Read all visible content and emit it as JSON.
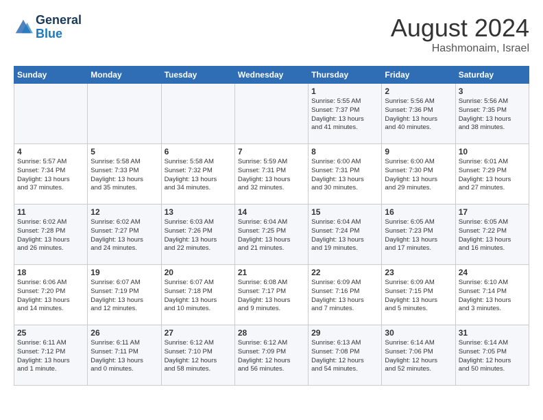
{
  "header": {
    "logo_line1": "General",
    "logo_line2": "Blue",
    "month_year": "August 2024",
    "location": "Hashmonaim, Israel"
  },
  "days_of_week": [
    "Sunday",
    "Monday",
    "Tuesday",
    "Wednesday",
    "Thursday",
    "Friday",
    "Saturday"
  ],
  "weeks": [
    [
      {
        "day": "",
        "info": ""
      },
      {
        "day": "",
        "info": ""
      },
      {
        "day": "",
        "info": ""
      },
      {
        "day": "",
        "info": ""
      },
      {
        "day": "1",
        "info": "Sunrise: 5:55 AM\nSunset: 7:37 PM\nDaylight: 13 hours\nand 41 minutes."
      },
      {
        "day": "2",
        "info": "Sunrise: 5:56 AM\nSunset: 7:36 PM\nDaylight: 13 hours\nand 40 minutes."
      },
      {
        "day": "3",
        "info": "Sunrise: 5:56 AM\nSunset: 7:35 PM\nDaylight: 13 hours\nand 38 minutes."
      }
    ],
    [
      {
        "day": "4",
        "info": "Sunrise: 5:57 AM\nSunset: 7:34 PM\nDaylight: 13 hours\nand 37 minutes."
      },
      {
        "day": "5",
        "info": "Sunrise: 5:58 AM\nSunset: 7:33 PM\nDaylight: 13 hours\nand 35 minutes."
      },
      {
        "day": "6",
        "info": "Sunrise: 5:58 AM\nSunset: 7:32 PM\nDaylight: 13 hours\nand 34 minutes."
      },
      {
        "day": "7",
        "info": "Sunrise: 5:59 AM\nSunset: 7:31 PM\nDaylight: 13 hours\nand 32 minutes."
      },
      {
        "day": "8",
        "info": "Sunrise: 6:00 AM\nSunset: 7:31 PM\nDaylight: 13 hours\nand 30 minutes."
      },
      {
        "day": "9",
        "info": "Sunrise: 6:00 AM\nSunset: 7:30 PM\nDaylight: 13 hours\nand 29 minutes."
      },
      {
        "day": "10",
        "info": "Sunrise: 6:01 AM\nSunset: 7:29 PM\nDaylight: 13 hours\nand 27 minutes."
      }
    ],
    [
      {
        "day": "11",
        "info": "Sunrise: 6:02 AM\nSunset: 7:28 PM\nDaylight: 13 hours\nand 26 minutes."
      },
      {
        "day": "12",
        "info": "Sunrise: 6:02 AM\nSunset: 7:27 PM\nDaylight: 13 hours\nand 24 minutes."
      },
      {
        "day": "13",
        "info": "Sunrise: 6:03 AM\nSunset: 7:26 PM\nDaylight: 13 hours\nand 22 minutes."
      },
      {
        "day": "14",
        "info": "Sunrise: 6:04 AM\nSunset: 7:25 PM\nDaylight: 13 hours\nand 21 minutes."
      },
      {
        "day": "15",
        "info": "Sunrise: 6:04 AM\nSunset: 7:24 PM\nDaylight: 13 hours\nand 19 minutes."
      },
      {
        "day": "16",
        "info": "Sunrise: 6:05 AM\nSunset: 7:23 PM\nDaylight: 13 hours\nand 17 minutes."
      },
      {
        "day": "17",
        "info": "Sunrise: 6:05 AM\nSunset: 7:22 PM\nDaylight: 13 hours\nand 16 minutes."
      }
    ],
    [
      {
        "day": "18",
        "info": "Sunrise: 6:06 AM\nSunset: 7:20 PM\nDaylight: 13 hours\nand 14 minutes."
      },
      {
        "day": "19",
        "info": "Sunrise: 6:07 AM\nSunset: 7:19 PM\nDaylight: 13 hours\nand 12 minutes."
      },
      {
        "day": "20",
        "info": "Sunrise: 6:07 AM\nSunset: 7:18 PM\nDaylight: 13 hours\nand 10 minutes."
      },
      {
        "day": "21",
        "info": "Sunrise: 6:08 AM\nSunset: 7:17 PM\nDaylight: 13 hours\nand 9 minutes."
      },
      {
        "day": "22",
        "info": "Sunrise: 6:09 AM\nSunset: 7:16 PM\nDaylight: 13 hours\nand 7 minutes."
      },
      {
        "day": "23",
        "info": "Sunrise: 6:09 AM\nSunset: 7:15 PM\nDaylight: 13 hours\nand 5 minutes."
      },
      {
        "day": "24",
        "info": "Sunrise: 6:10 AM\nSunset: 7:14 PM\nDaylight: 13 hours\nand 3 minutes."
      }
    ],
    [
      {
        "day": "25",
        "info": "Sunrise: 6:11 AM\nSunset: 7:12 PM\nDaylight: 13 hours\nand 1 minute."
      },
      {
        "day": "26",
        "info": "Sunrise: 6:11 AM\nSunset: 7:11 PM\nDaylight: 13 hours\nand 0 minutes."
      },
      {
        "day": "27",
        "info": "Sunrise: 6:12 AM\nSunset: 7:10 PM\nDaylight: 12 hours\nand 58 minutes."
      },
      {
        "day": "28",
        "info": "Sunrise: 6:12 AM\nSunset: 7:09 PM\nDaylight: 12 hours\nand 56 minutes."
      },
      {
        "day": "29",
        "info": "Sunrise: 6:13 AM\nSunset: 7:08 PM\nDaylight: 12 hours\nand 54 minutes."
      },
      {
        "day": "30",
        "info": "Sunrise: 6:14 AM\nSunset: 7:06 PM\nDaylight: 12 hours\nand 52 minutes."
      },
      {
        "day": "31",
        "info": "Sunrise: 6:14 AM\nSunset: 7:05 PM\nDaylight: 12 hours\nand 50 minutes."
      }
    ]
  ]
}
